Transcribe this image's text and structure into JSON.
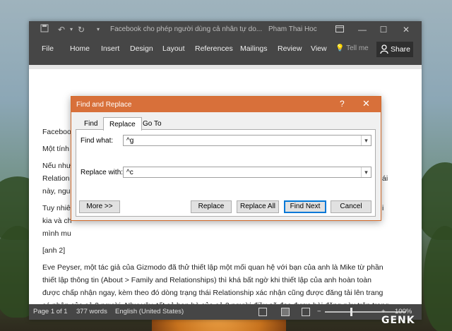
{
  "window": {
    "title": "Facebook cho phép người dùng cả nhân tự do...",
    "user": "Pham Thai Hoc"
  },
  "ribbon": {
    "tabs": [
      "File",
      "Home",
      "Insert",
      "Design",
      "Layout",
      "References",
      "Mailings",
      "Review",
      "View"
    ],
    "tell_me": "Tell me",
    "share": "Share"
  },
  "document": {
    "lines": [
      "Faceboo",
      "Một tính",
      "Nếu như",
      "Relation",
      "này, ngu",
      "Tuy nhiê",
      "kia và ch",
      "mình mu",
      "[anh 2]",
      "Eve Peyser, một tác giả của Gizmodo đã thử thiết lập một mối quan hệ với bạn của anh là Mike từ phần",
      "thiết lập thông tin (About > Family and Relationships) thì khá bất ngờ khi thiết lập của anh hoàn toàn",
      "được chấp nhận ngay, kèm theo đó dòng trạng thái Relationship xác nhận cũng được đăng tải lên trang",
      "cá nhân của cả 2 người. Như vậy, tất cả bạn bè của cả 2 người điều sẽ đọc được bài đăng này trên trang"
    ],
    "right_fragments": [
      "ái",
      "i"
    ]
  },
  "status": {
    "page": "Page 1 of 1",
    "words": "377 words",
    "language": "English (United States)",
    "zoom": "100%",
    "zoom_minus": "−",
    "zoom_plus": "+"
  },
  "dialog": {
    "title": "Find and Replace",
    "help": "?",
    "close": "✕",
    "tabs": [
      "Find",
      "Replace",
      "Go To"
    ],
    "active_tab": "Replace",
    "find_label": "Find what:",
    "find_value": "^g",
    "replace_label": "Replace with:",
    "replace_value": "^c",
    "buttons": {
      "more": "More >>",
      "replace": "Replace",
      "replace_all": "Replace All",
      "find_next": "Find Next",
      "cancel": "Cancel"
    }
  },
  "watermark": "GENK"
}
